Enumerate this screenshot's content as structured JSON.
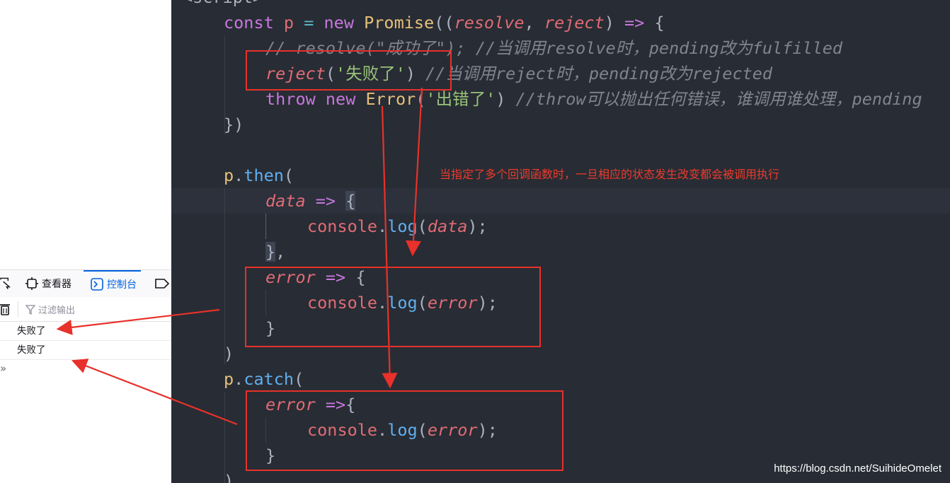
{
  "devtools": {
    "tabs": [
      {
        "label": "查看器",
        "icon": "inspector-icon"
      },
      {
        "label": "控制台",
        "icon": "console-icon"
      }
    ],
    "filter_placeholder": "过滤输出",
    "console_rows": [
      "失败了",
      "失败了"
    ],
    "prompt": "»"
  },
  "editor": {
    "lines": {
      "l0": "<script>",
      "l1_const": "const",
      "l1_p": "p",
      "l1_new": "new",
      "l1_promise": "Promise",
      "l1_resolve": "resolve",
      "l1_reject": "reject",
      "l2_comment": "// resolve(\"成功了\"); //当调用resolve时，pending改为fulfilled",
      "l3_reject": "reject",
      "l3_str": "'失败了'",
      "l3_comment": "//当调用reject时，pending改为rejected",
      "l4_throw": "throw",
      "l4_new": "new",
      "l4_error": "Error",
      "l4_str": "'出错了'",
      "l4_comment": "//throw可以抛出任何错误，谁调用谁处理，pending",
      "l5": "})",
      "l7_p": "p",
      "l7_then": "then",
      "l8_data": "data",
      "l9_console": "console",
      "l9_log": "log",
      "l9_arg": "data",
      "l11_error": "error",
      "l12_console": "console",
      "l12_log": "log",
      "l12_arg": "error",
      "l14": ")",
      "l15_p": "p",
      "l15_catch": "catch",
      "l16_error": "error",
      "l17_console": "console",
      "l17_log": "log",
      "l17_arg": "error"
    }
  },
  "annotation": "当指定了多个回调函数时，一旦相应的状态发生改变都会被调用执行",
  "watermark": "https://blog.csdn.net/SuihideOmelet",
  "colors": {
    "annotation_red": "#e8312a",
    "editor_bg": "#282c34"
  }
}
